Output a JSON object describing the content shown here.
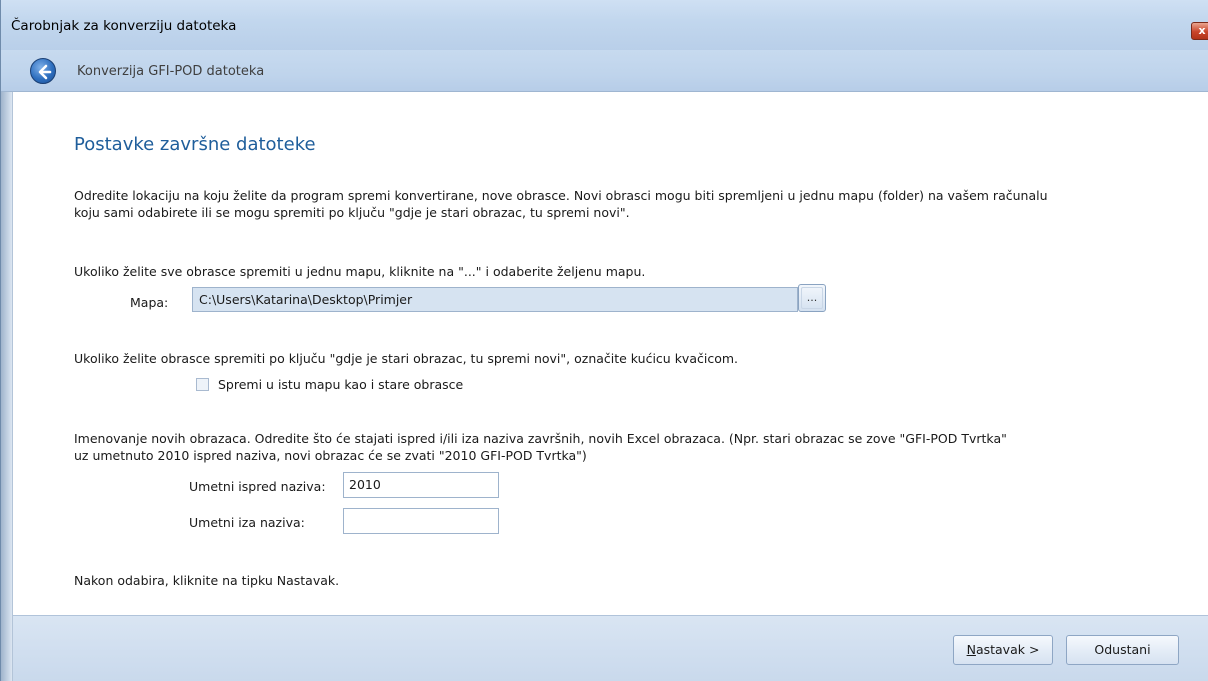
{
  "window": {
    "title": "Čarobnjak za konverziju datoteka",
    "close_label": "x"
  },
  "navbar": {
    "title": "Konverzija GFI-POD datoteka"
  },
  "content": {
    "heading": "Postavke završne datoteke",
    "intro_line1": "Odredite lokaciju na koju želite da program spremi konvertirane, nove obrasce. Novi obrasci mogu biti spremljeni u jednu mapu (folder) na vašem računalu",
    "intro_line2": "koju sami odabirete ili se mogu spremiti po ključu \"gdje je stari obrazac, tu spremi novi\".",
    "single_folder_instruction": "Ukoliko želite sve obrasce spremiti u jednu mapu, kliknite na \"...\" i odaberite željenu mapu.",
    "folder_label": "Mapa:",
    "folder_value": "C:\\Users\\Katarina\\Desktop\\Primjer",
    "browse_label": "...",
    "same_folder_instruction": "Ukoliko želite obrasce spremiti po ključu \"gdje je stari obrazac, tu spremi novi\", označite kućicu kvačicom.",
    "same_folder_checkbox_label": "Spremi u istu mapu kao i stare obrasce",
    "same_folder_checked": false,
    "naming_line1": "Imenovanje novih obrazaca. Odredite što će stajati ispred i/ili iza naziva završnih, novih Excel obrazaca. (Npr. stari obrazac se zove \"GFI-POD Tvrtka\"",
    "naming_line2": "uz umetnuto 2010 ispred naziva, novi obrazac će se zvati \"2010 GFI-POD Tvrtka\")",
    "prefix_label": "Umetni ispred naziva:",
    "prefix_value": "2010",
    "suffix_label": "Umetni iza naziva:",
    "suffix_value": "",
    "closing_instruction": "Nakon odabira, kliknite na tipku Nastavak."
  },
  "footer": {
    "next_accel": "N",
    "next_rest": "astavak >",
    "cancel_label": "Odustani"
  }
}
